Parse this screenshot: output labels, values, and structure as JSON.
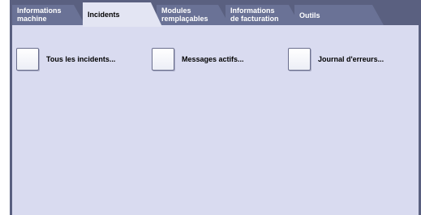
{
  "tabs": [
    {
      "label": "Informations\nmachine",
      "active": false
    },
    {
      "label": "Incidents",
      "active": true
    },
    {
      "label": "Modules\nremplaçables",
      "active": false
    },
    {
      "label": "Informations\nde facturation",
      "active": false
    },
    {
      "label": "Outils",
      "active": false
    }
  ],
  "options": [
    {
      "label": "Tous les incidents...",
      "icon": "checkbox-button"
    },
    {
      "label": "Messages actifs...",
      "icon": "checkbox-button"
    },
    {
      "label": "Journal d'erreurs...",
      "icon": "checkbox-button"
    }
  ],
  "colors": {
    "frame": "#5a6080",
    "tab_inactive": "#6a7296",
    "panel": "#d9dbf0"
  }
}
